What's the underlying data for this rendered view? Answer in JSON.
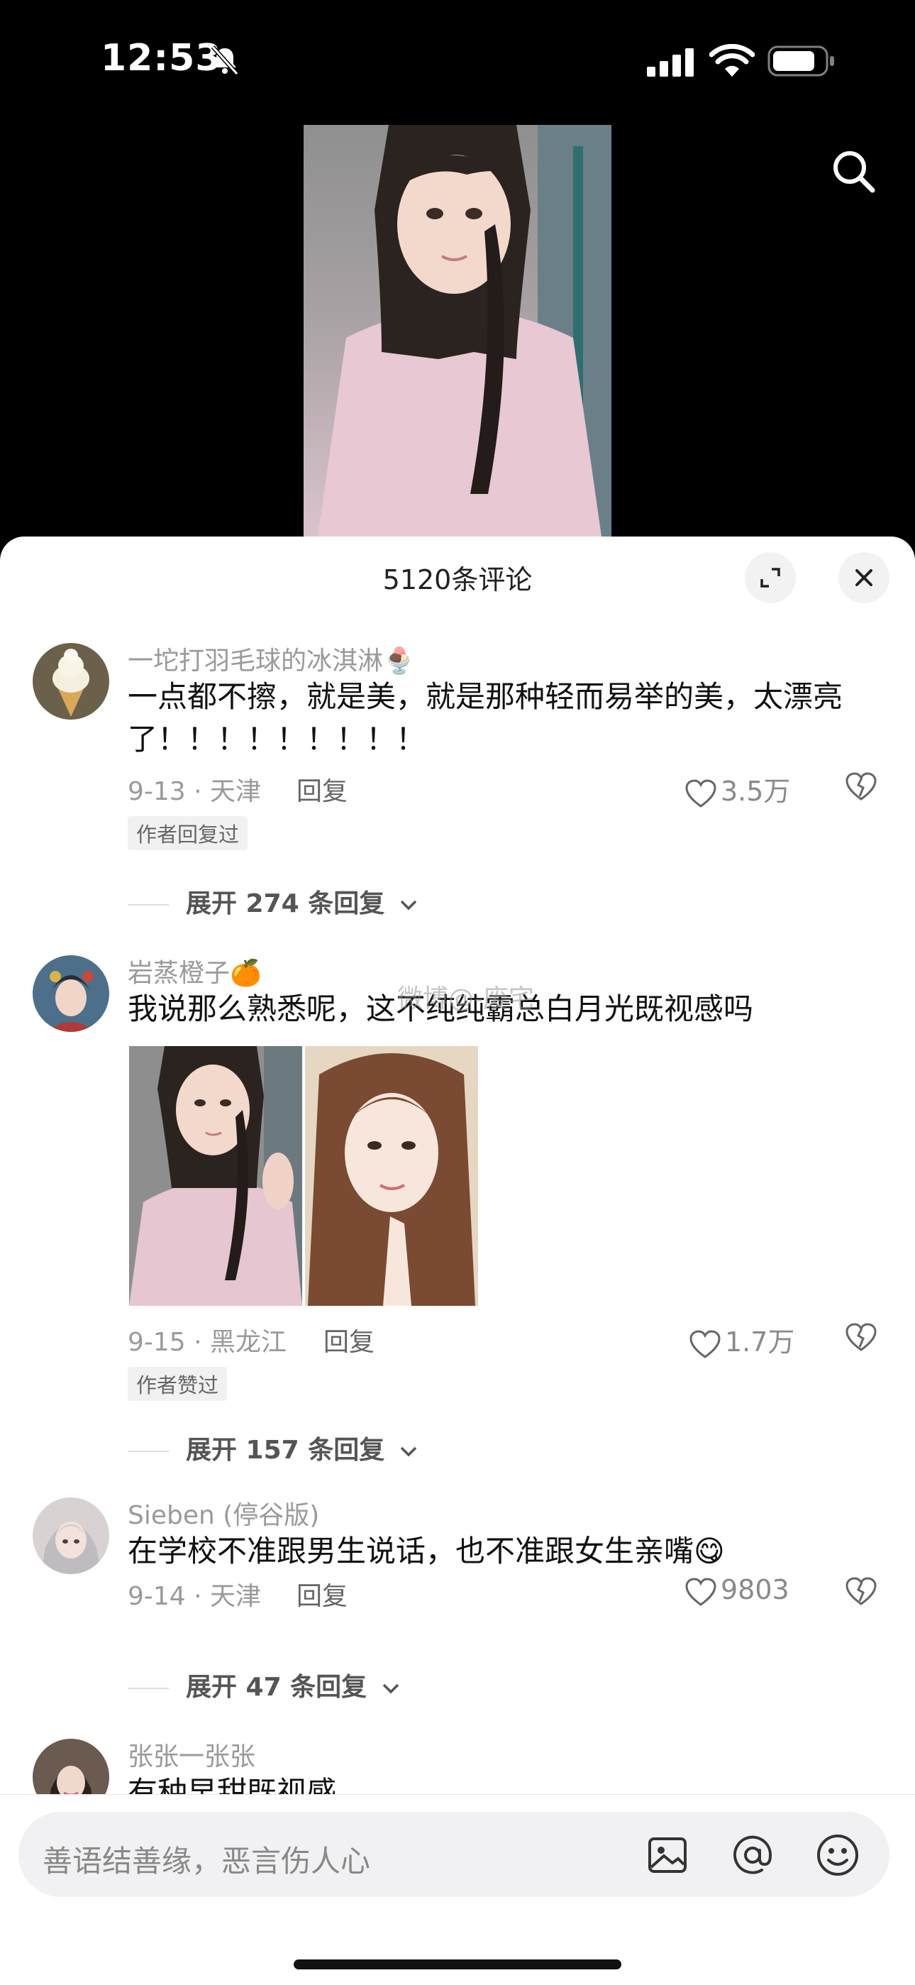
{
  "status_bar": {
    "time": "12:53"
  },
  "sheet": {
    "title": "5120条评论"
  },
  "comments": [
    {
      "username": "一坨打羽毛球的冰淇淋🍨",
      "text": "一点都不擦，就是美，就是那种轻而易举的美，太漂亮了！！！！！！！！！",
      "date": "9-13 · 天津",
      "reply": "回复",
      "likes": "3.5万",
      "badge": "作者回复过",
      "expand": "展开 274 条回复"
    },
    {
      "username": "岩蒸橙子🍊",
      "text": "我说那么熟悉呢，这不纯纯霸总白月光既视感吗",
      "date": "9-15 · 黑龙江",
      "reply": "回复",
      "likes": "1.7万",
      "badge": "作者赞过",
      "expand": "展开 157 条回复"
    },
    {
      "username": "Sieben (停谷版)",
      "text": "在学校不准跟男生说话，也不准跟女生亲嘴😋",
      "date": "9-14 · 天津",
      "reply": "回复",
      "likes": "9803",
      "expand": "展开 47 条回复"
    },
    {
      "username": "张张一张张",
      "text": "有种早甜既视感"
    }
  ],
  "watermark": "微博@-废宅",
  "input": {
    "placeholder": "善语结善缘，恶言伤人心"
  },
  "icons": [
    "mute-icon",
    "signal-icon",
    "wifi-icon",
    "battery-icon",
    "search-icon",
    "expand-icon",
    "close-icon",
    "heart-icon",
    "dislike-icon",
    "chevron-down-icon",
    "image-icon",
    "at-icon",
    "emoji-icon"
  ]
}
